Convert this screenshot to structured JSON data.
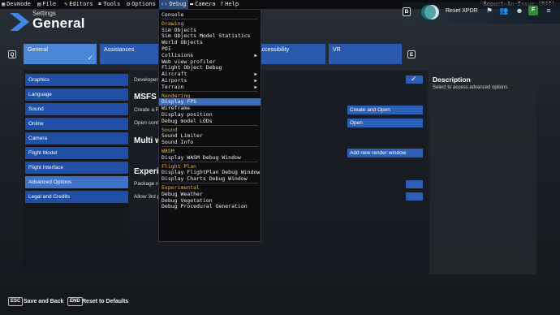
{
  "menubar": {
    "items": [
      {
        "icon": "devmode-icon",
        "glyph": "▣",
        "label": "Devmode"
      },
      {
        "icon": "file-icon",
        "glyph": "▤",
        "label": "File"
      },
      {
        "icon": "pencil-icon",
        "glyph": "✎",
        "label": "Editors"
      },
      {
        "icon": "wrench-icon",
        "glyph": "✖",
        "label": "Tools"
      },
      {
        "icon": "gear-icon",
        "glyph": "⚙",
        "label": "Options"
      },
      {
        "icon": "code-icon",
        "glyph": "‹›",
        "label": "Debug"
      },
      {
        "icon": "camera-icon",
        "glyph": "▬",
        "label": "Camera"
      },
      {
        "icon": "help-icon",
        "glyph": "?",
        "label": "Help"
      }
    ],
    "report": "Report-An-Issue (RAI)"
  },
  "header": {
    "section": "Settings",
    "title": "General"
  },
  "topright": {
    "b_key": "B",
    "xpdr": "Reset XPDR",
    "app_letter": "F"
  },
  "tabs": {
    "q_key": "Q",
    "e_key": "E",
    "items": [
      "General",
      "Assistances",
      "",
      "Accessibility",
      "VR"
    ]
  },
  "left_menu": [
    "Graphics",
    "Language",
    "Sound",
    "Online",
    "Camera",
    "Flight Model",
    "Flight Interface",
    "Advanced Options",
    "Legal and Credits"
  ],
  "main": {
    "developer_mode": "Developer",
    "section1": "MSFS S",
    "create_row": "Create a R",
    "open_row": "Open conte",
    "create_btn": "Create and Open",
    "open_btn": "Open",
    "section2": "Multi wi",
    "add_render_btn": "Add new render window",
    "section3": "Experim",
    "package_row": "Package re",
    "allow_row": "Allow 3rd p"
  },
  "description": {
    "title": "Description",
    "text": "Select to access advanced options."
  },
  "bottom": {
    "esc_key": "ESC",
    "esc_label": "Save and Back",
    "end_key": "END",
    "end_label": "Reset to Defaults"
  },
  "debug_menu": [
    {
      "type": "item",
      "label": "Console"
    },
    {
      "type": "sep"
    },
    {
      "type": "section",
      "label": "Drawing"
    },
    {
      "type": "item",
      "label": "Sim Objects"
    },
    {
      "type": "item",
      "label": "Sim Objects Model Statistics"
    },
    {
      "type": "item",
      "label": "World Objects"
    },
    {
      "type": "item",
      "label": "POI"
    },
    {
      "type": "item",
      "label": "Collisions",
      "submenu": true
    },
    {
      "type": "item",
      "label": "Web view profiler"
    },
    {
      "type": "item",
      "label": "Flight Object Debug"
    },
    {
      "type": "item",
      "label": "Aircraft",
      "submenu": true
    },
    {
      "type": "item",
      "label": "Airports",
      "submenu": true
    },
    {
      "type": "item",
      "label": "Terrain",
      "submenu": true
    },
    {
      "type": "sep"
    },
    {
      "type": "section",
      "label": "Rendering"
    },
    {
      "type": "item",
      "label": "Display FPS",
      "highlight": true
    },
    {
      "type": "item",
      "label": "Wireframe"
    },
    {
      "type": "item",
      "label": "Display position"
    },
    {
      "type": "item",
      "label": "Debug model LODs"
    },
    {
      "type": "sep"
    },
    {
      "type": "section",
      "label": "Sound"
    },
    {
      "type": "item",
      "label": "Sound Limiter"
    },
    {
      "type": "item",
      "label": "Sound Info"
    },
    {
      "type": "sep"
    },
    {
      "type": "section",
      "label": "WASM"
    },
    {
      "type": "item",
      "label": "Display WASM Debug Window"
    },
    {
      "type": "sep"
    },
    {
      "type": "section",
      "label": "Flight Plan"
    },
    {
      "type": "item",
      "label": "Display FlightPlan Debug Window"
    },
    {
      "type": "item",
      "label": "Display Charts Debug Window"
    },
    {
      "type": "sep"
    },
    {
      "type": "section",
      "label": "Experimental"
    },
    {
      "type": "item",
      "label": "Debug Weather"
    },
    {
      "type": "item",
      "label": "Debug Vegetation"
    },
    {
      "type": "item",
      "label": "Debug Procedural Generation"
    }
  ],
  "colors": {
    "accent": "#2b5fb8",
    "selected": "#4a86d8",
    "section": "#f0b030"
  }
}
